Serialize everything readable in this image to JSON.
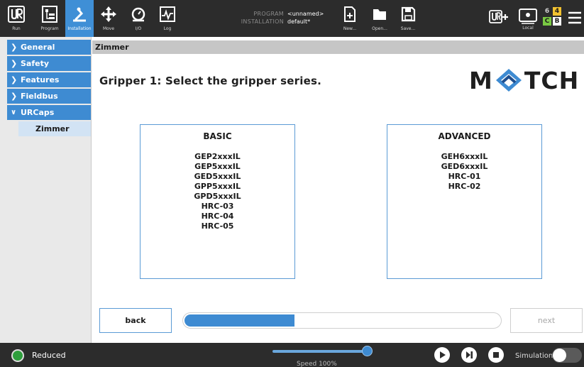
{
  "topbar": {
    "nav": [
      {
        "label": "Run",
        "icon": "ur-logo-icon"
      },
      {
        "label": "Program",
        "icon": "program-icon"
      },
      {
        "label": "Installation",
        "icon": "installation-icon",
        "active": true
      },
      {
        "label": "Move",
        "icon": "move-icon"
      },
      {
        "label": "I/O",
        "icon": "io-icon"
      },
      {
        "label": "Log",
        "icon": "log-icon"
      }
    ],
    "program_key": "PROGRAM",
    "program_value": "<unnamed>",
    "installation_key": "INSTALLATION",
    "installation_value": "default*",
    "file_actions": [
      {
        "label": "New...",
        "icon": "new-file-icon"
      },
      {
        "label": "Open...",
        "icon": "open-folder-icon"
      },
      {
        "label": "Save...",
        "icon": "save-icon"
      }
    ],
    "local_label": "Local",
    "badges": [
      "6",
      "4",
      "C",
      "B"
    ]
  },
  "sidebar": {
    "items": [
      {
        "label": "General",
        "expanded": false
      },
      {
        "label": "Safety",
        "expanded": false
      },
      {
        "label": "Features",
        "expanded": false
      },
      {
        "label": "Fieldbus",
        "expanded": false
      },
      {
        "label": "URCaps",
        "expanded": true
      }
    ],
    "sub_items": [
      {
        "label": "Zimmer",
        "selected": true
      }
    ]
  },
  "main": {
    "breadcrumb": "Zimmer",
    "heading": "Gripper 1: Select the gripper series.",
    "logo_text_left": "M",
    "logo_text_right": "TCH",
    "basic": {
      "title": "BASIC",
      "models": [
        "GEP2xxxIL",
        "GEP5xxxIL",
        "GED5xxxIL",
        "GPP5xxxIL",
        "GPD5xxxIL",
        "HRC-03",
        "HRC-04",
        "HRC-05"
      ]
    },
    "advanced": {
      "title": "ADVANCED",
      "models": [
        "GEH6xxxIL",
        "GED6xxxIL",
        "HRC-01",
        "HRC-02"
      ]
    },
    "back_label": "back",
    "next_label": "next",
    "progress": 0.35
  },
  "bottombar": {
    "status": "Reduced",
    "speed_label": "Speed 100%",
    "speed_value": 1.0,
    "simulation_label": "Simulation",
    "simulation_on": false
  },
  "colors": {
    "accent": "#3e8bd2",
    "topbar": "#2c2c2c",
    "status_green": "#2e9e3c",
    "badge_green": "#7ac943",
    "badge_yellow": "#f2c230"
  }
}
